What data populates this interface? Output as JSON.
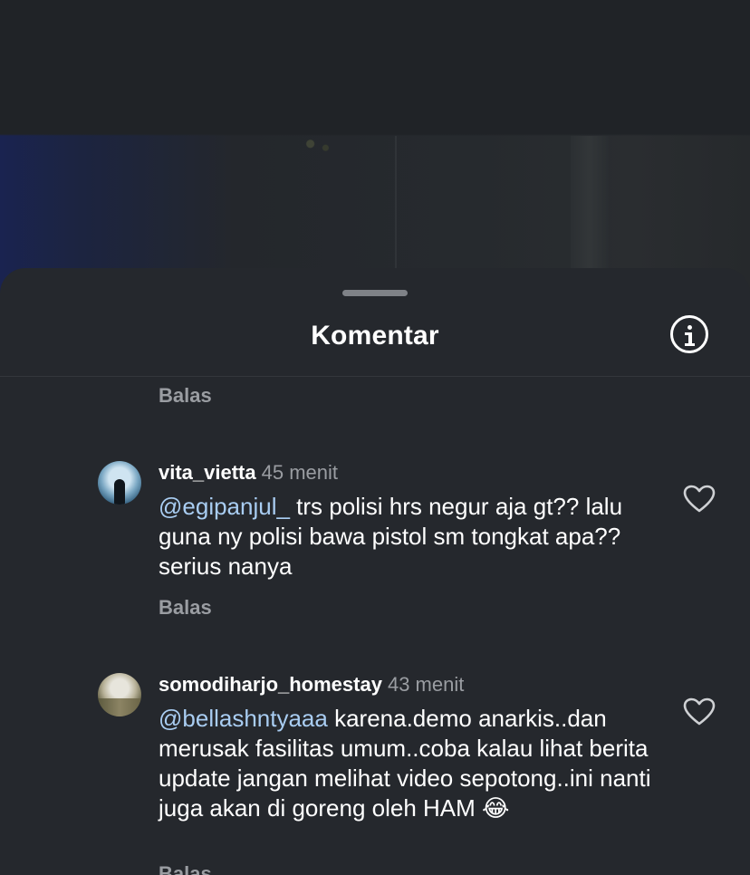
{
  "sheet": {
    "title": "Komentar",
    "info_icon": "info-icon"
  },
  "top_reply": {
    "label": "Balas"
  },
  "comments": [
    {
      "username": "vita_vietta",
      "time": "45 menit",
      "mention": "@egipanjul_",
      "text": " trs polisi hrs negur aja gt?? lalu guna ny polisi bawa pistol sm tongkat apa??serius nanya",
      "reply_label": "Balas",
      "like_icon": "heart-icon"
    },
    {
      "username": "somodiharjo_homestay",
      "time": "43 menit",
      "mention": "@bellashntyaaa",
      "text": " karena.demo anarkis..dan merusak fasilitas umum..coba kalau lihat berita update jangan melihat video sepotong..ini nanti juga akan di goreng oleh HAM 😂",
      "reply_label": "Balas",
      "like_icon": "heart-icon"
    }
  ]
}
